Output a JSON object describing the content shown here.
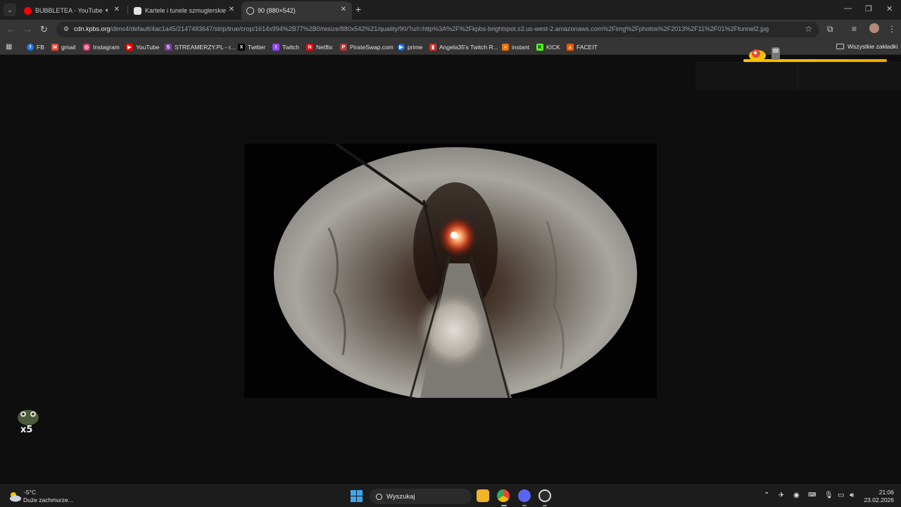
{
  "browser": {
    "tabs": [
      {
        "title": "BUBBLETEA - YouTube",
        "favicon": "youtube-icon",
        "audio": true,
        "active": false
      },
      {
        "title": "Kartele i tunele szmuglerskie",
        "favicon": "chatgpt-icon",
        "audio": false,
        "active": false
      },
      {
        "title": "90 (880×542)",
        "favicon": "globe-icon",
        "audio": false,
        "active": true
      }
    ],
    "url_host": "cdn.kpbs.org",
    "url_path": "/dims4/default/4ac1a45/2147483647/strip/true/crop/1614x994%2B77%2B0/resize/880x542%21/quality/90/?url=http%3A%2F%2Fkpbs-brightspot.s3.us-west-2.amazonaws.com%2Fimg%2Fphotos%2F2013%2F11%2F01%2Ftunnel2.jpg",
    "bookmarks": [
      {
        "label": "FB",
        "icon": "facebook-icon",
        "color": "#1877f2"
      },
      {
        "label": "gmail",
        "icon": "gmail-icon",
        "color": "#ea4335"
      },
      {
        "label": "Instagram",
        "icon": "instagram-icon",
        "color": "#e1306c"
      },
      {
        "label": "YouTube",
        "icon": "youtube-icon",
        "color": "#ff0000"
      },
      {
        "label": "STREAMERZY.PL - r...",
        "icon": "streamerzy-icon",
        "color": "#7b3fa0"
      },
      {
        "label": "Twitter",
        "icon": "x-icon",
        "color": "#000000"
      },
      {
        "label": "Twitch",
        "icon": "twitch-icon",
        "color": "#9146ff"
      },
      {
        "label": "Netflix",
        "icon": "netflix-icon",
        "color": "#e50914"
      },
      {
        "label": "PirateSwap.com",
        "icon": "pirateswap-icon",
        "color": "#b33a3a"
      },
      {
        "label": "prime",
        "icon": "prime-icon",
        "color": "#1a73e8"
      },
      {
        "label": "Angela35's Twitch R...",
        "icon": "chart-icon",
        "color": "#d93025"
      },
      {
        "label": "instant",
        "icon": "instant-icon",
        "color": "#e8710a"
      },
      {
        "label": "KICK",
        "icon": "kick-icon",
        "color": "#53fc18"
      },
      {
        "label": "FACEIT",
        "icon": "faceit-icon",
        "color": "#ff5500"
      }
    ],
    "all_bookmarks_label": "Wszystkie zakładki"
  },
  "page": {
    "image_name": "tunnel-photo",
    "widget_count": "x5"
  },
  "taskbar": {
    "weather_temp": "-5°C",
    "weather_desc": "Duże zachmurze...",
    "search_placeholder": "Wyszukaj",
    "time": "21:06",
    "date": "23.02.2026",
    "accent": "#3ea6f2"
  }
}
